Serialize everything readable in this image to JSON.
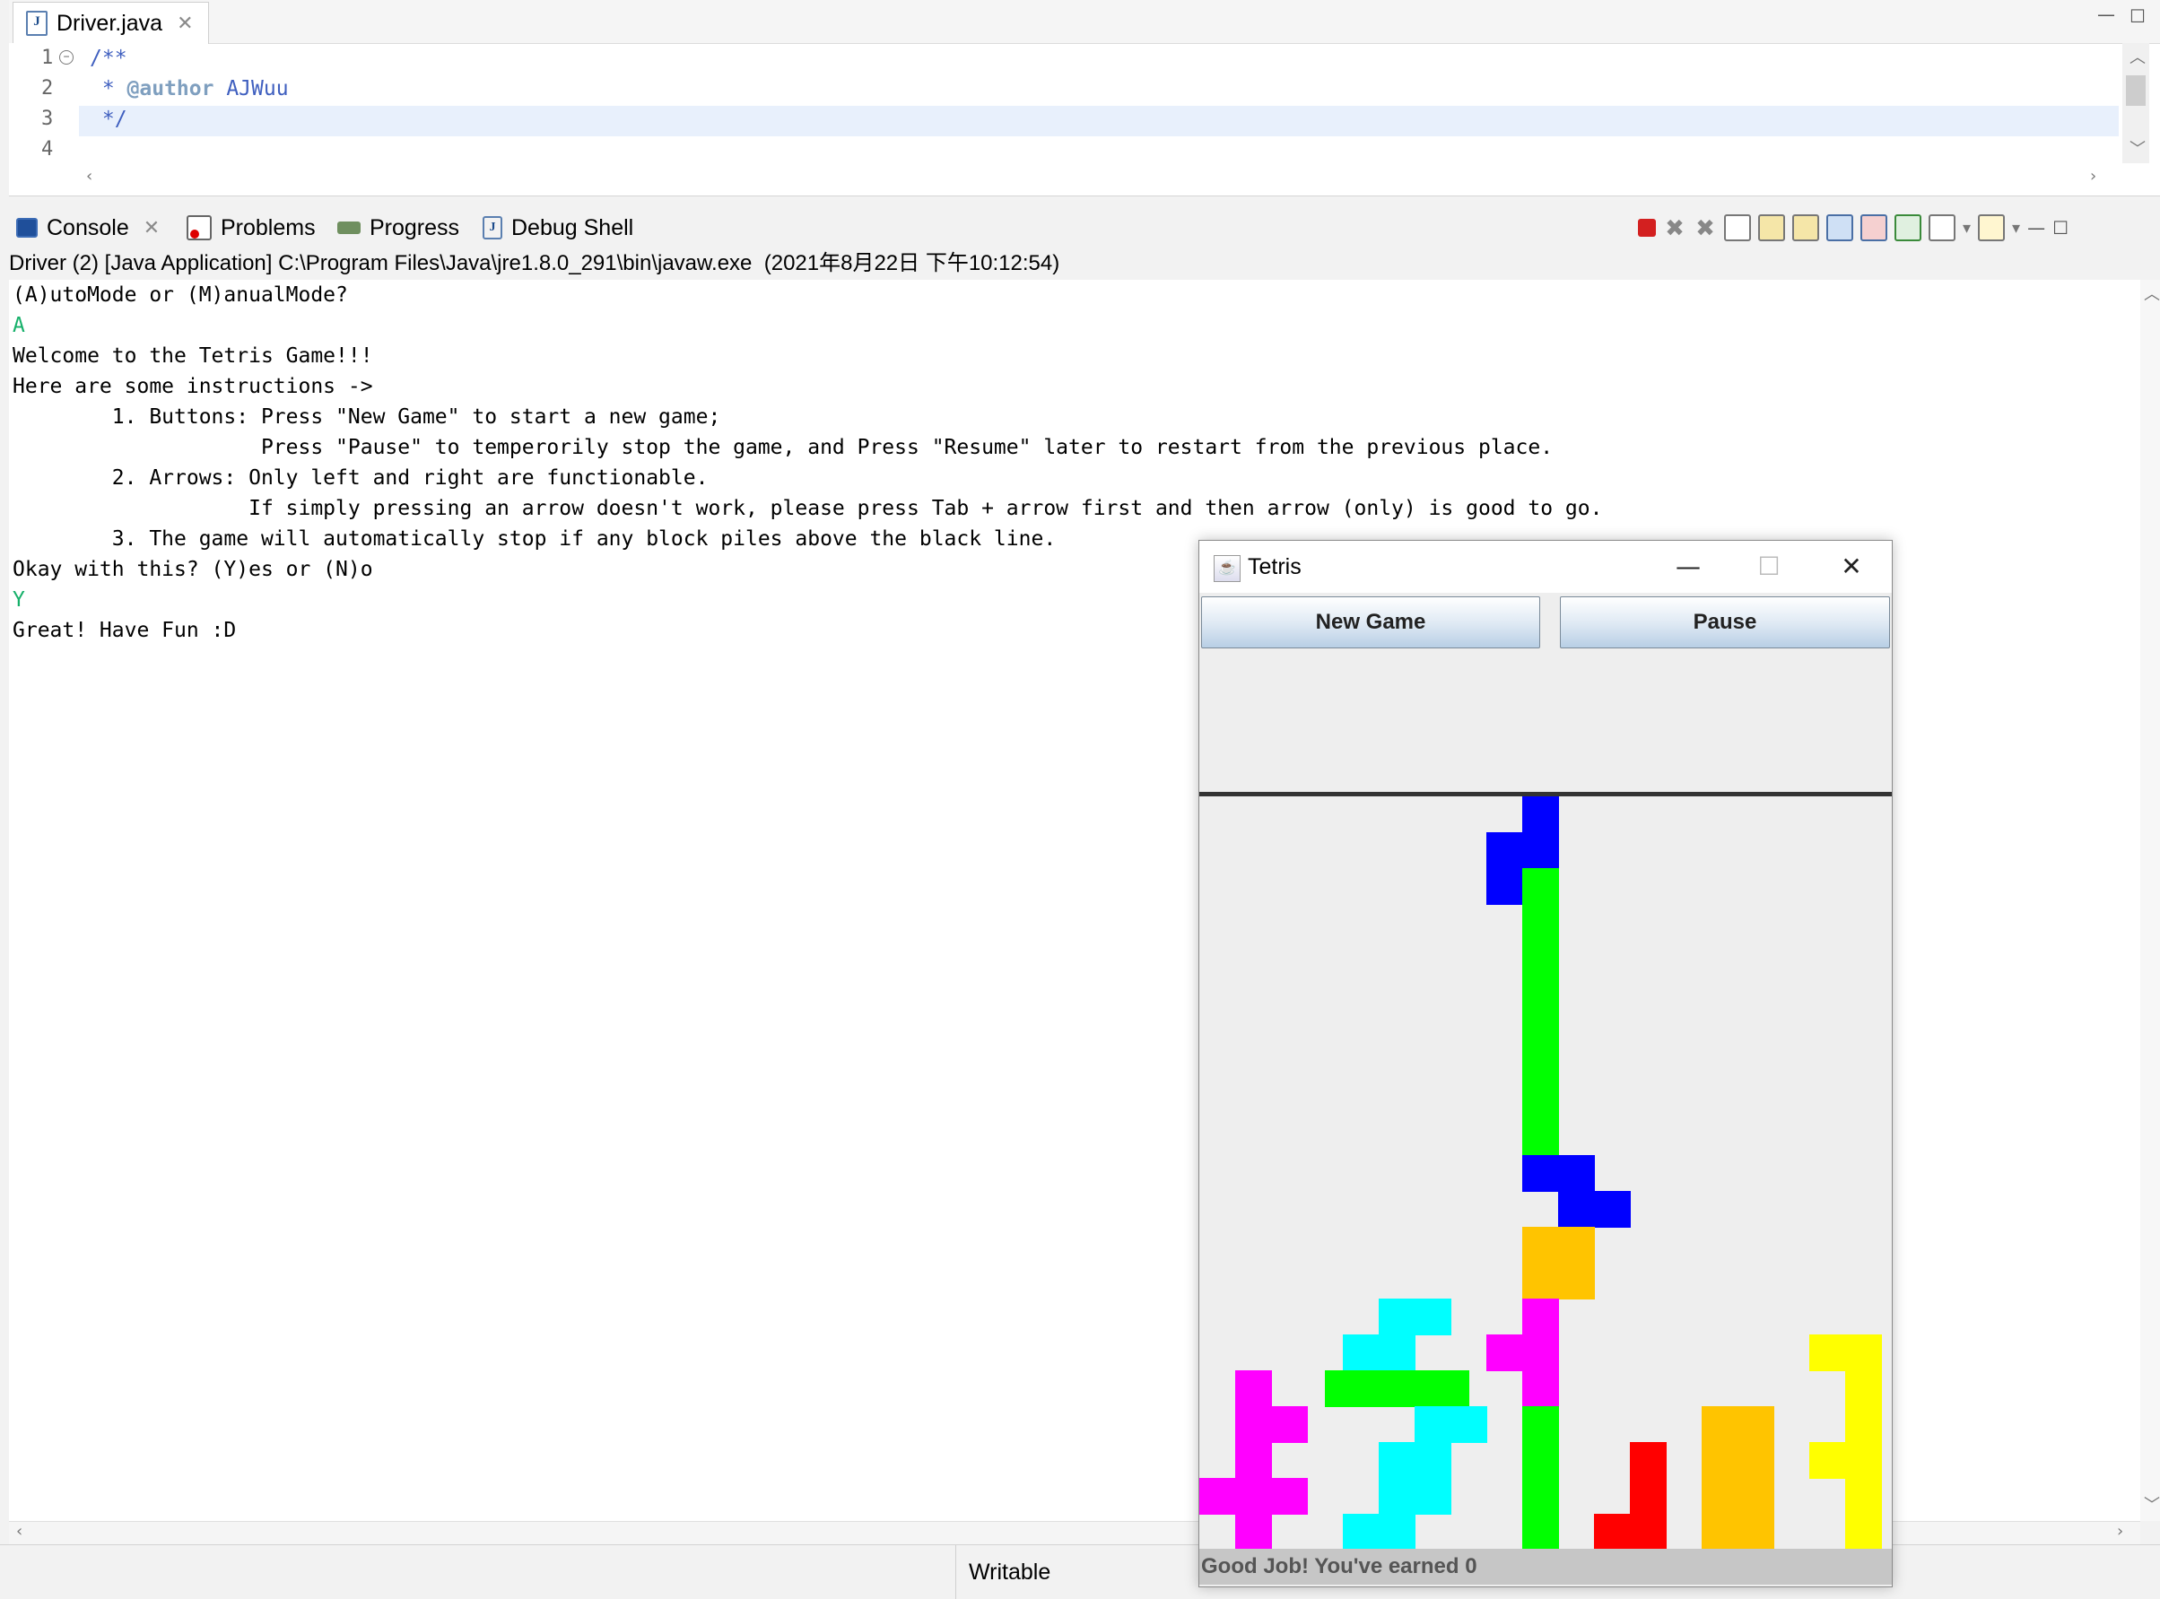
{
  "editor": {
    "tab_label": "Driver.java",
    "tab_icon": "java-file-icon",
    "close_glyph": "✕",
    "minimize_glyph": "—",
    "maximize_glyph": "☐",
    "lines": [
      {
        "num": "1",
        "text": "/**"
      },
      {
        "num": "2",
        "text_prefix": " * ",
        "tag": "@author",
        "text_suffix": " AJWuu"
      },
      {
        "num": "3",
        "text": " */"
      },
      {
        "num": "4",
        "text": ""
      }
    ]
  },
  "console_view": {
    "tabs": [
      {
        "label": "Console",
        "icon": "console-icon",
        "active": true
      },
      {
        "label": "Problems",
        "icon": "problems-icon"
      },
      {
        "label": "Progress",
        "icon": "progress-icon"
      },
      {
        "label": "Debug Shell",
        "icon": "debug-shell-icon"
      }
    ],
    "description": "Driver (2) [Java Application] C:\\Program Files\\Java\\jre1.8.0_291\\bin\\javaw.exe  (2021年8月22日 下午10:12:54)",
    "lines": [
      {
        "text": "(A)utoMode or (M)anualMode?",
        "input": false
      },
      {
        "text": "A",
        "input": true
      },
      {
        "text": "Welcome to the Tetris Game!!!",
        "input": false
      },
      {
        "text": "Here are some instructions ->",
        "input": false
      },
      {
        "text": "        1. Buttons: Press \"New Game\" to start a new game;",
        "input": false
      },
      {
        "text": "                    Press \"Pause\" to temperorily stop the game, and Press \"Resume\" later to restart from the previous place.",
        "input": false
      },
      {
        "text": "        2. Arrows: Only left and right are functionable.",
        "input": false
      },
      {
        "text": "                   If simply pressing an arrow doesn't work, please press Tab + arrow first and then arrow (only) is good to go.",
        "input": false
      },
      {
        "text": "        3. The game will automatically stop if any block piles above the black line.",
        "input": false
      },
      {
        "text": "Okay with this? (Y)es or (N)o",
        "input": false
      },
      {
        "text": "Y",
        "input": true
      },
      {
        "text": "Great! Have Fun :D",
        "input": false
      }
    ],
    "input_color": "#16b06a"
  },
  "statusbar": {
    "writable": "Writable"
  },
  "tetris": {
    "title": "Tetris",
    "minimize_glyph": "—",
    "maximize_glyph": "☐",
    "close_glyph": "✕",
    "new_game_label": "New Game",
    "pause_label": "Pause",
    "status_text": "Good Job! You've earned 0",
    "colors": {
      "blue": "#0000ff",
      "green": "#00ff00",
      "magenta": "#ff00ff",
      "cyan": "#00ffff",
      "orange": "#ffc400",
      "red": "#ff0000",
      "yellow": "#ffff00",
      "limit_line": "#333333"
    },
    "cells": [
      {
        "c": 9,
        "r": 0,
        "color": "blue"
      },
      {
        "c": 8,
        "r": 1,
        "color": "blue"
      },
      {
        "c": 9,
        "r": 1,
        "color": "blue"
      },
      {
        "c": 8,
        "r": 2,
        "color": "blue"
      },
      {
        "c": 9,
        "r": 2,
        "color": "green"
      },
      {
        "c": 9,
        "r": 3,
        "color": "green"
      },
      {
        "c": 9,
        "r": 4,
        "color": "green"
      },
      {
        "c": 9,
        "r": 5,
        "color": "green"
      },
      {
        "c": 9,
        "r": 6,
        "color": "green"
      },
      {
        "c": 9,
        "r": 7,
        "color": "green"
      },
      {
        "c": 9,
        "r": 8,
        "color": "green"
      },
      {
        "c": 9,
        "r": 9,
        "color": "green"
      },
      {
        "c": 9,
        "r": 10,
        "color": "blue"
      },
      {
        "c": 10,
        "r": 10,
        "color": "blue"
      },
      {
        "c": 10,
        "r": 11,
        "color": "blue"
      },
      {
        "c": 11,
        "r": 11,
        "color": "blue"
      },
      {
        "c": 9,
        "r": 12,
        "color": "orange"
      },
      {
        "c": 10,
        "r": 12,
        "color": "orange"
      },
      {
        "c": 9,
        "r": 13,
        "color": "orange"
      },
      {
        "c": 10,
        "r": 13,
        "color": "orange"
      },
      {
        "c": 9,
        "r": 14,
        "color": "magenta"
      },
      {
        "c": 8,
        "r": 15,
        "color": "magenta"
      },
      {
        "c": 9,
        "r": 15,
        "color": "magenta"
      },
      {
        "c": 9,
        "r": 16,
        "color": "magenta"
      },
      {
        "c": 9,
        "r": 17,
        "color": "green"
      },
      {
        "c": 9,
        "r": 18,
        "color": "green"
      },
      {
        "c": 9,
        "r": 19,
        "color": "green"
      },
      {
        "c": 9,
        "r": 20,
        "color": "green"
      },
      {
        "c": 5,
        "r": 14,
        "color": "cyan"
      },
      {
        "c": 6,
        "r": 14,
        "color": "cyan"
      },
      {
        "c": 4,
        "r": 15,
        "color": "cyan"
      },
      {
        "c": 5,
        "r": 15,
        "color": "cyan"
      },
      {
        "c": 3.5,
        "r": 16,
        "color": "green"
      },
      {
        "c": 4.5,
        "r": 16,
        "color": "green"
      },
      {
        "c": 5.5,
        "r": 16,
        "color": "green"
      },
      {
        "c": 6.5,
        "r": 16,
        "color": "green"
      },
      {
        "c": 6,
        "r": 17,
        "color": "cyan"
      },
      {
        "c": 7,
        "r": 17,
        "color": "cyan"
      },
      {
        "c": 5,
        "r": 18,
        "color": "cyan"
      },
      {
        "c": 6,
        "r": 18,
        "color": "cyan"
      },
      {
        "c": 5,
        "r": 19,
        "color": "cyan"
      },
      {
        "c": 6,
        "r": 19,
        "color": "cyan"
      },
      {
        "c": 4,
        "r": 20,
        "color": "cyan"
      },
      {
        "c": 5,
        "r": 20,
        "color": "cyan"
      },
      {
        "c": 1,
        "r": 16,
        "color": "magenta"
      },
      {
        "c": 1,
        "r": 17,
        "color": "magenta"
      },
      {
        "c": 2,
        "r": 17,
        "color": "magenta"
      },
      {
        "c": 1,
        "r": 18,
        "color": "magenta"
      },
      {
        "c": 0,
        "r": 19,
        "color": "magenta"
      },
      {
        "c": 1,
        "r": 19,
        "color": "magenta"
      },
      {
        "c": 2,
        "r": 19,
        "color": "magenta"
      },
      {
        "c": 1,
        "r": 20,
        "color": "magenta"
      },
      {
        "c": 12,
        "r": 18,
        "color": "red"
      },
      {
        "c": 12,
        "r": 19,
        "color": "red"
      },
      {
        "c": 11,
        "r": 20,
        "color": "red"
      },
      {
        "c": 12,
        "r": 20,
        "color": "red"
      },
      {
        "c": 14,
        "r": 17,
        "color": "orange"
      },
      {
        "c": 15,
        "r": 17,
        "color": "orange"
      },
      {
        "c": 14,
        "r": 18,
        "color": "orange"
      },
      {
        "c": 15,
        "r": 18,
        "color": "orange"
      },
      {
        "c": 14,
        "r": 19,
        "color": "orange"
      },
      {
        "c": 15,
        "r": 19,
        "color": "orange"
      },
      {
        "c": 14,
        "r": 20,
        "color": "orange"
      },
      {
        "c": 15,
        "r": 20,
        "color": "orange"
      },
      {
        "c": 17,
        "r": 15,
        "color": "yellow"
      },
      {
        "c": 18,
        "r": 15,
        "color": "yellow"
      },
      {
        "c": 18,
        "r": 16,
        "color": "yellow"
      },
      {
        "c": 18,
        "r": 17,
        "color": "yellow"
      },
      {
        "c": 17,
        "r": 18,
        "color": "yellow"
      },
      {
        "c": 18,
        "r": 18,
        "color": "yellow"
      },
      {
        "c": 18,
        "r": 19,
        "color": "yellow"
      },
      {
        "c": 18,
        "r": 20,
        "color": "yellow"
      }
    ]
  }
}
